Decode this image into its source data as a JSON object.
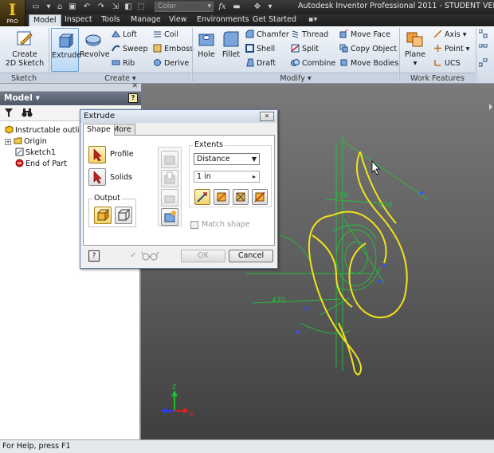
{
  "app": {
    "app_button_big": "I",
    "app_button_sub": "PRO",
    "title": "Autodesk Inventor Professional 2011 - STUDENT VERSION"
  },
  "quick_access": {
    "color_select": "Color",
    "fx_label": "fx"
  },
  "tabs": [
    {
      "label": "Model",
      "active": true
    },
    {
      "label": "Inspect",
      "active": false
    },
    {
      "label": "Tools",
      "active": false
    },
    {
      "label": "Manage",
      "active": false
    },
    {
      "label": "View",
      "active": false
    },
    {
      "label": "Environments",
      "active": false
    },
    {
      "label": "Get Started",
      "active": false
    }
  ],
  "ribbon": {
    "sketch": {
      "title": "Sketch",
      "create_2d_line1": "Create",
      "create_2d_line2": "2D Sketch"
    },
    "create": {
      "title": "Create",
      "extrude": "Extrude",
      "revolve": "Revolve",
      "loft": "Loft",
      "sweep": "Sweep",
      "rib": "Rib",
      "coil": "Coil",
      "emboss": "Emboss",
      "derive": "Derive"
    },
    "modify": {
      "title": "Modify",
      "hole": "Hole",
      "fillet": "Fillet",
      "chamfer": "Chamfer",
      "shell": "Shell",
      "draft": "Draft",
      "thread": "Thread",
      "split": "Split",
      "combine": "Combine",
      "move_face": "Move Face",
      "copy_object": "Copy Object",
      "move_bodies": "Move Bodies"
    },
    "work_features": {
      "title": "Work Features",
      "plane": "Plane",
      "axis": "Axis",
      "point": "Point",
      "ucs": "UCS"
    }
  },
  "browser": {
    "title": "Model",
    "help": "?",
    "tree": [
      {
        "label": "Instructable outline"
      },
      {
        "label": "Origin"
      },
      {
        "label": "Sketch1"
      },
      {
        "label": "End of Part"
      }
    ]
  },
  "dialog": {
    "title": "Extrude",
    "tab_shape": "Shape",
    "tab_more": "More",
    "profile": "Profile",
    "solids": "Solids",
    "output": "Output",
    "extents": "Extents",
    "extents_value": "Distance",
    "distance_value": "1 in",
    "match_shape": "Match shape",
    "ok": "OK",
    "cancel": "Cancel",
    "help": "?"
  },
  "viewport": {
    "dimensions": [
      "750",
      "470",
      "470"
    ],
    "axis_z": "Z",
    "axis_x": "X",
    "colors": {
      "profile": "#f2e21a",
      "sketch": "#22c23a",
      "point": "#3a4dff"
    }
  },
  "status": {
    "text": "For Help, press F1"
  }
}
